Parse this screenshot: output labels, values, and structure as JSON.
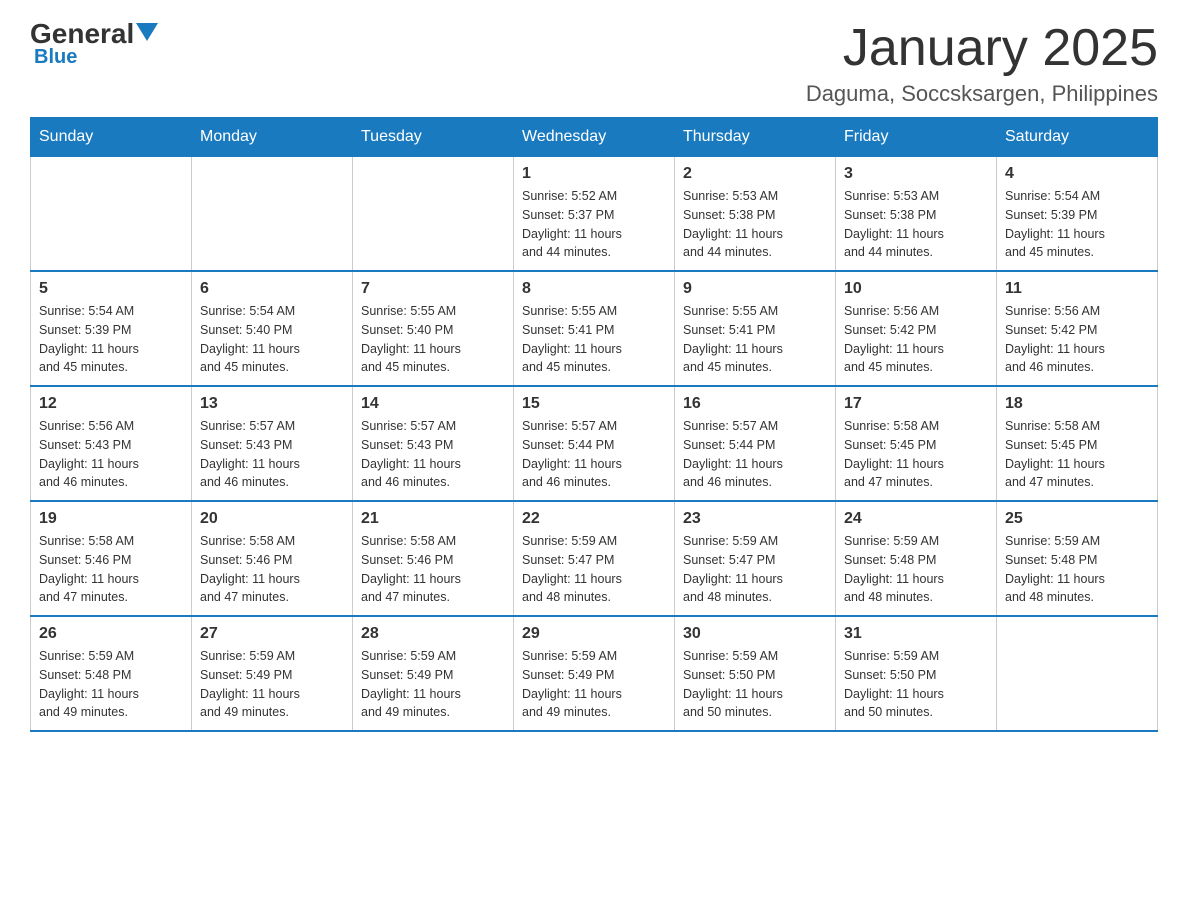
{
  "logo": {
    "general": "General",
    "triangle": "▼",
    "blue": "Blue"
  },
  "title": "January 2025",
  "subtitle": "Daguma, Soccsksargen, Philippines",
  "weekdays": [
    "Sunday",
    "Monday",
    "Tuesday",
    "Wednesday",
    "Thursday",
    "Friday",
    "Saturday"
  ],
  "weeks": [
    [
      {
        "day": "",
        "info": ""
      },
      {
        "day": "",
        "info": ""
      },
      {
        "day": "",
        "info": ""
      },
      {
        "day": "1",
        "info": "Sunrise: 5:52 AM\nSunset: 5:37 PM\nDaylight: 11 hours\nand 44 minutes."
      },
      {
        "day": "2",
        "info": "Sunrise: 5:53 AM\nSunset: 5:38 PM\nDaylight: 11 hours\nand 44 minutes."
      },
      {
        "day": "3",
        "info": "Sunrise: 5:53 AM\nSunset: 5:38 PM\nDaylight: 11 hours\nand 44 minutes."
      },
      {
        "day": "4",
        "info": "Sunrise: 5:54 AM\nSunset: 5:39 PM\nDaylight: 11 hours\nand 45 minutes."
      }
    ],
    [
      {
        "day": "5",
        "info": "Sunrise: 5:54 AM\nSunset: 5:39 PM\nDaylight: 11 hours\nand 45 minutes."
      },
      {
        "day": "6",
        "info": "Sunrise: 5:54 AM\nSunset: 5:40 PM\nDaylight: 11 hours\nand 45 minutes."
      },
      {
        "day": "7",
        "info": "Sunrise: 5:55 AM\nSunset: 5:40 PM\nDaylight: 11 hours\nand 45 minutes."
      },
      {
        "day": "8",
        "info": "Sunrise: 5:55 AM\nSunset: 5:41 PM\nDaylight: 11 hours\nand 45 minutes."
      },
      {
        "day": "9",
        "info": "Sunrise: 5:55 AM\nSunset: 5:41 PM\nDaylight: 11 hours\nand 45 minutes."
      },
      {
        "day": "10",
        "info": "Sunrise: 5:56 AM\nSunset: 5:42 PM\nDaylight: 11 hours\nand 45 minutes."
      },
      {
        "day": "11",
        "info": "Sunrise: 5:56 AM\nSunset: 5:42 PM\nDaylight: 11 hours\nand 46 minutes."
      }
    ],
    [
      {
        "day": "12",
        "info": "Sunrise: 5:56 AM\nSunset: 5:43 PM\nDaylight: 11 hours\nand 46 minutes."
      },
      {
        "day": "13",
        "info": "Sunrise: 5:57 AM\nSunset: 5:43 PM\nDaylight: 11 hours\nand 46 minutes."
      },
      {
        "day": "14",
        "info": "Sunrise: 5:57 AM\nSunset: 5:43 PM\nDaylight: 11 hours\nand 46 minutes."
      },
      {
        "day": "15",
        "info": "Sunrise: 5:57 AM\nSunset: 5:44 PM\nDaylight: 11 hours\nand 46 minutes."
      },
      {
        "day": "16",
        "info": "Sunrise: 5:57 AM\nSunset: 5:44 PM\nDaylight: 11 hours\nand 46 minutes."
      },
      {
        "day": "17",
        "info": "Sunrise: 5:58 AM\nSunset: 5:45 PM\nDaylight: 11 hours\nand 47 minutes."
      },
      {
        "day": "18",
        "info": "Sunrise: 5:58 AM\nSunset: 5:45 PM\nDaylight: 11 hours\nand 47 minutes."
      }
    ],
    [
      {
        "day": "19",
        "info": "Sunrise: 5:58 AM\nSunset: 5:46 PM\nDaylight: 11 hours\nand 47 minutes."
      },
      {
        "day": "20",
        "info": "Sunrise: 5:58 AM\nSunset: 5:46 PM\nDaylight: 11 hours\nand 47 minutes."
      },
      {
        "day": "21",
        "info": "Sunrise: 5:58 AM\nSunset: 5:46 PM\nDaylight: 11 hours\nand 47 minutes."
      },
      {
        "day": "22",
        "info": "Sunrise: 5:59 AM\nSunset: 5:47 PM\nDaylight: 11 hours\nand 48 minutes."
      },
      {
        "day": "23",
        "info": "Sunrise: 5:59 AM\nSunset: 5:47 PM\nDaylight: 11 hours\nand 48 minutes."
      },
      {
        "day": "24",
        "info": "Sunrise: 5:59 AM\nSunset: 5:48 PM\nDaylight: 11 hours\nand 48 minutes."
      },
      {
        "day": "25",
        "info": "Sunrise: 5:59 AM\nSunset: 5:48 PM\nDaylight: 11 hours\nand 48 minutes."
      }
    ],
    [
      {
        "day": "26",
        "info": "Sunrise: 5:59 AM\nSunset: 5:48 PM\nDaylight: 11 hours\nand 49 minutes."
      },
      {
        "day": "27",
        "info": "Sunrise: 5:59 AM\nSunset: 5:49 PM\nDaylight: 11 hours\nand 49 minutes."
      },
      {
        "day": "28",
        "info": "Sunrise: 5:59 AM\nSunset: 5:49 PM\nDaylight: 11 hours\nand 49 minutes."
      },
      {
        "day": "29",
        "info": "Sunrise: 5:59 AM\nSunset: 5:49 PM\nDaylight: 11 hours\nand 49 minutes."
      },
      {
        "day": "30",
        "info": "Sunrise: 5:59 AM\nSunset: 5:50 PM\nDaylight: 11 hours\nand 50 minutes."
      },
      {
        "day": "31",
        "info": "Sunrise: 5:59 AM\nSunset: 5:50 PM\nDaylight: 11 hours\nand 50 minutes."
      },
      {
        "day": "",
        "info": ""
      }
    ]
  ]
}
